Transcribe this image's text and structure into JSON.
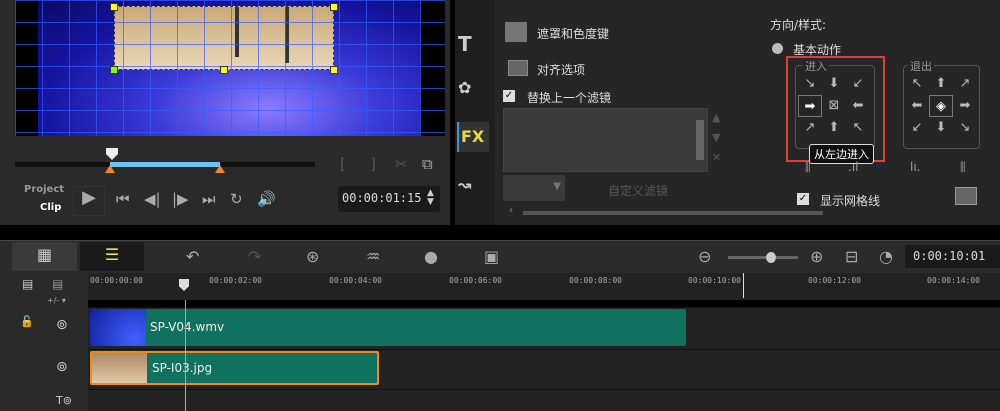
{
  "player": {
    "project_label": "Project",
    "clip_label": "Clip",
    "timecode": "00:00:01:15"
  },
  "options": {
    "mask_label": "遮罩和色度键",
    "align_label": "对齐选项",
    "replace_filter_label": "替换上一个滤镜",
    "replace_filter_checked": true,
    "custom_filter_label": "自定义滤镜",
    "direction_label": "方向/样式:",
    "basic_motion_label": "基本动作",
    "enter_label": "进入",
    "exit_label": "退出",
    "tooltip": "从左边进入",
    "show_grid_label": "显示网格线",
    "show_grid_checked": true,
    "side_tabs": [
      "media",
      "title",
      "graphics",
      "fx",
      "path"
    ]
  },
  "timeline": {
    "timecode": "0:00:10:01",
    "ruler": [
      "00:00:00:00",
      "00:00:02:00",
      "00:00:04:00",
      "00:00:06:00",
      "00:00:08:00",
      "00:00:10:00",
      "00:00:12:00",
      "00:00:14:00"
    ],
    "add_remove_label": "+/- ▾",
    "clips": {
      "video": "SP-V04.wmv",
      "overlay": "SP-I03.jpg"
    },
    "zoom_level": 0.6
  },
  "colors": {
    "accent": "#f08a1c",
    "clip": "#10715e",
    "highlight": "#e23c3c",
    "range": "#6fc3ee"
  }
}
